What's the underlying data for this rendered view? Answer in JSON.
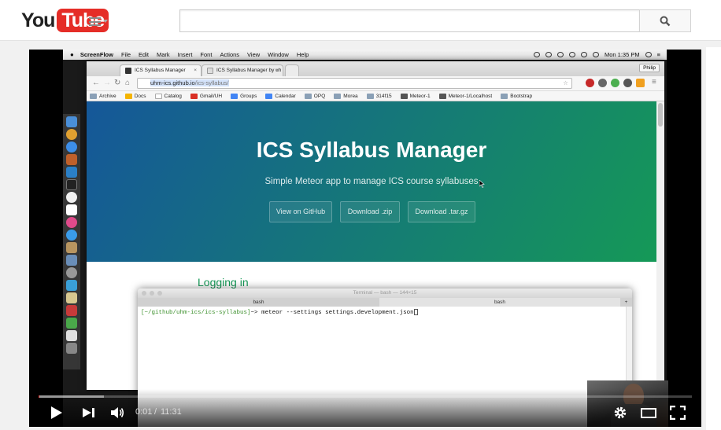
{
  "youtube": {
    "logo_you": "You",
    "logo_tube": "Tube",
    "search": {
      "value": "",
      "placeholder": ""
    }
  },
  "video": {
    "mac_menubar": {
      "items": [
        "ScreenFlow",
        "File",
        "Edit",
        "Mark",
        "Insert",
        "Font",
        "Actions",
        "View",
        "Window",
        "Help"
      ],
      "clock": "Mon 1:35 PM"
    },
    "browser": {
      "tabs": [
        "ICS Syllabus Manager",
        "ICS Syllabus Manager by uh"
      ],
      "profile": "Philip",
      "url_host": "uhm-ics.github.io",
      "url_path": "/ics-syllabus/",
      "bookmarks": [
        "Archive",
        "Docs",
        "Catalog",
        "Gmail/UH",
        "Groups",
        "Calendar",
        "OPQ",
        "Morea",
        "314f15",
        "Meteor-1",
        "Meteor-1/Localhost",
        "Bootstrap"
      ],
      "page": {
        "title": "ICS Syllabus Manager",
        "subtitle": "Simple Meteor app to manage ICS course syllabuses",
        "buttons": [
          "View on GitHub",
          "Download .zip",
          "Download .tar.gz"
        ],
        "section_heading": "Logging in"
      }
    },
    "terminal": {
      "title": "Terminal — bash — 144×15",
      "tabs": [
        "bash",
        "bash"
      ],
      "add_tab": "+",
      "prompt_path": "[~/github/uhm-ics/ics-syllabus]",
      "prompt_arrow": "~>",
      "command": "meteor --settings settings.development.json"
    }
  },
  "player": {
    "time_current": "0:01",
    "time_separator": "/",
    "time_total": "11:31",
    "progress": 0.001,
    "buffered": 0.1
  },
  "colors": {
    "youtube_red": "#e52d27",
    "hero_start": "#155799",
    "hero_end": "#159957"
  }
}
